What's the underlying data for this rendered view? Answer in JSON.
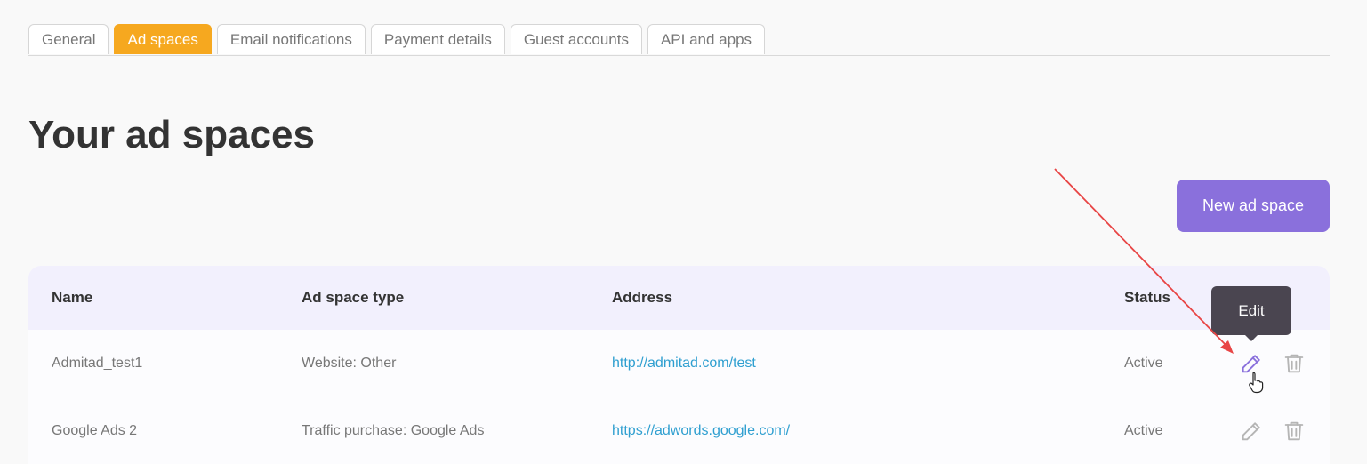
{
  "tabs": [
    {
      "label": "General",
      "active": false
    },
    {
      "label": "Ad spaces",
      "active": true
    },
    {
      "label": "Email notifications",
      "active": false
    },
    {
      "label": "Payment details",
      "active": false
    },
    {
      "label": "Guest accounts",
      "active": false
    },
    {
      "label": "API and apps",
      "active": false
    }
  ],
  "title": "Your ad spaces",
  "new_button": "New ad space",
  "table": {
    "headers": [
      "Name",
      "Ad space type",
      "Address",
      "Status"
    ],
    "rows": [
      {
        "name": "Admitad_test1",
        "type": "Website: Other",
        "address": "http://admitad.com/test",
        "status": "Active"
      },
      {
        "name": "Google Ads 2",
        "type": "Traffic purchase: Google Ads",
        "address": "https://adwords.google.com/",
        "status": "Active"
      }
    ]
  },
  "tooltip": "Edit",
  "icons": {
    "edit": "pencil-icon",
    "delete": "trash-icon",
    "cursor": "hand-pointer-icon"
  },
  "colors": {
    "accent_tab": "#f6a81f",
    "primary_button": "#8a70dc",
    "header_bg": "#f2f0fd",
    "link": "#2f9fd0",
    "annotation_arrow": "#e84545",
    "edit_icon_active": "#8a70dc",
    "icon_idle": "#b5b5b5"
  }
}
